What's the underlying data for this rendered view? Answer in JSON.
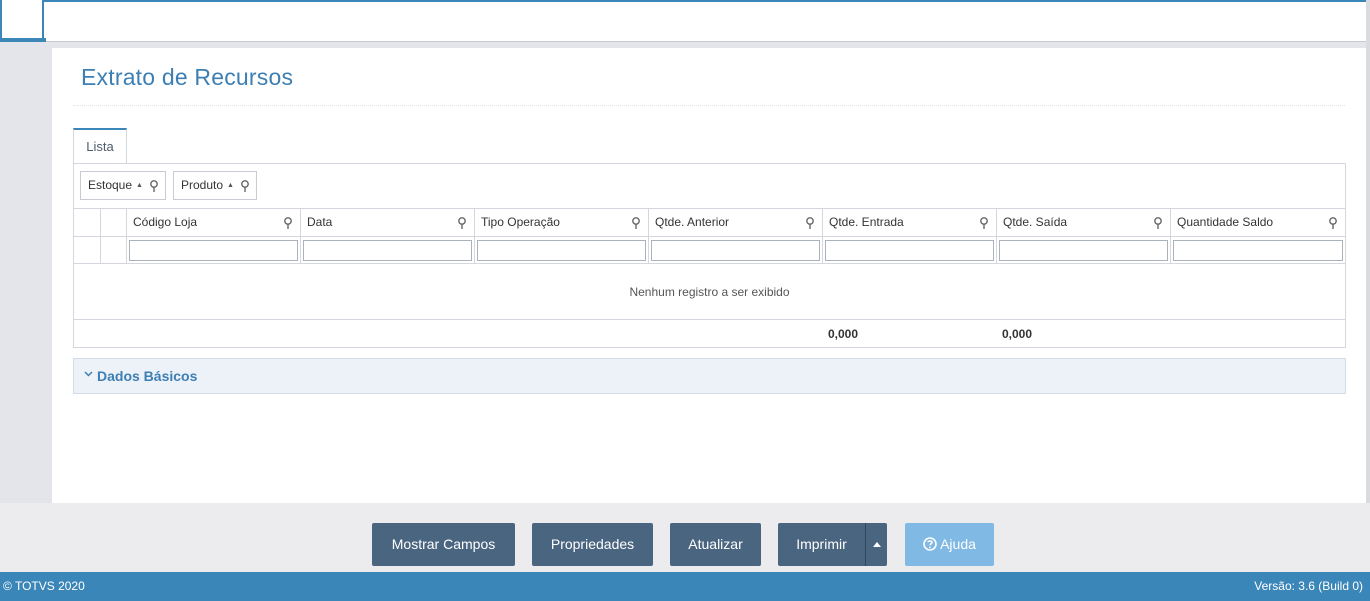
{
  "page": {
    "title": "Extrato de Recursos"
  },
  "tabs": [
    {
      "label": "Lista"
    }
  ],
  "grid": {
    "group_chips": [
      {
        "label": "Estoque"
      },
      {
        "label": "Produto"
      }
    ],
    "columns": [
      {
        "label": "Código Loja"
      },
      {
        "label": "Data"
      },
      {
        "label": "Tipo Operação"
      },
      {
        "label": "Qtde. Anterior"
      },
      {
        "label": "Qtde. Entrada"
      },
      {
        "label": "Qtde. Saída"
      },
      {
        "label": "Quantidade Saldo"
      }
    ],
    "empty_message": "Nenhum registro a ser exibido",
    "totals": {
      "entrada": "0,000",
      "saida": "0,000"
    }
  },
  "accordion": {
    "label": "Dados Básicos"
  },
  "actions": {
    "mostrar_campos": "Mostrar Campos",
    "propriedades": "Propriedades",
    "atualizar": "Atualizar",
    "imprimir": "Imprimir",
    "ajuda": "Ajuda"
  },
  "status": {
    "copyright": "© TOTVS 2020",
    "version": "Versão: 3.6 (Build 0)"
  },
  "colors": {
    "accent": "#3d86b8",
    "button": "#4a6580",
    "help_button": "#7fb9e4",
    "statusbar": "#3b86b9"
  }
}
